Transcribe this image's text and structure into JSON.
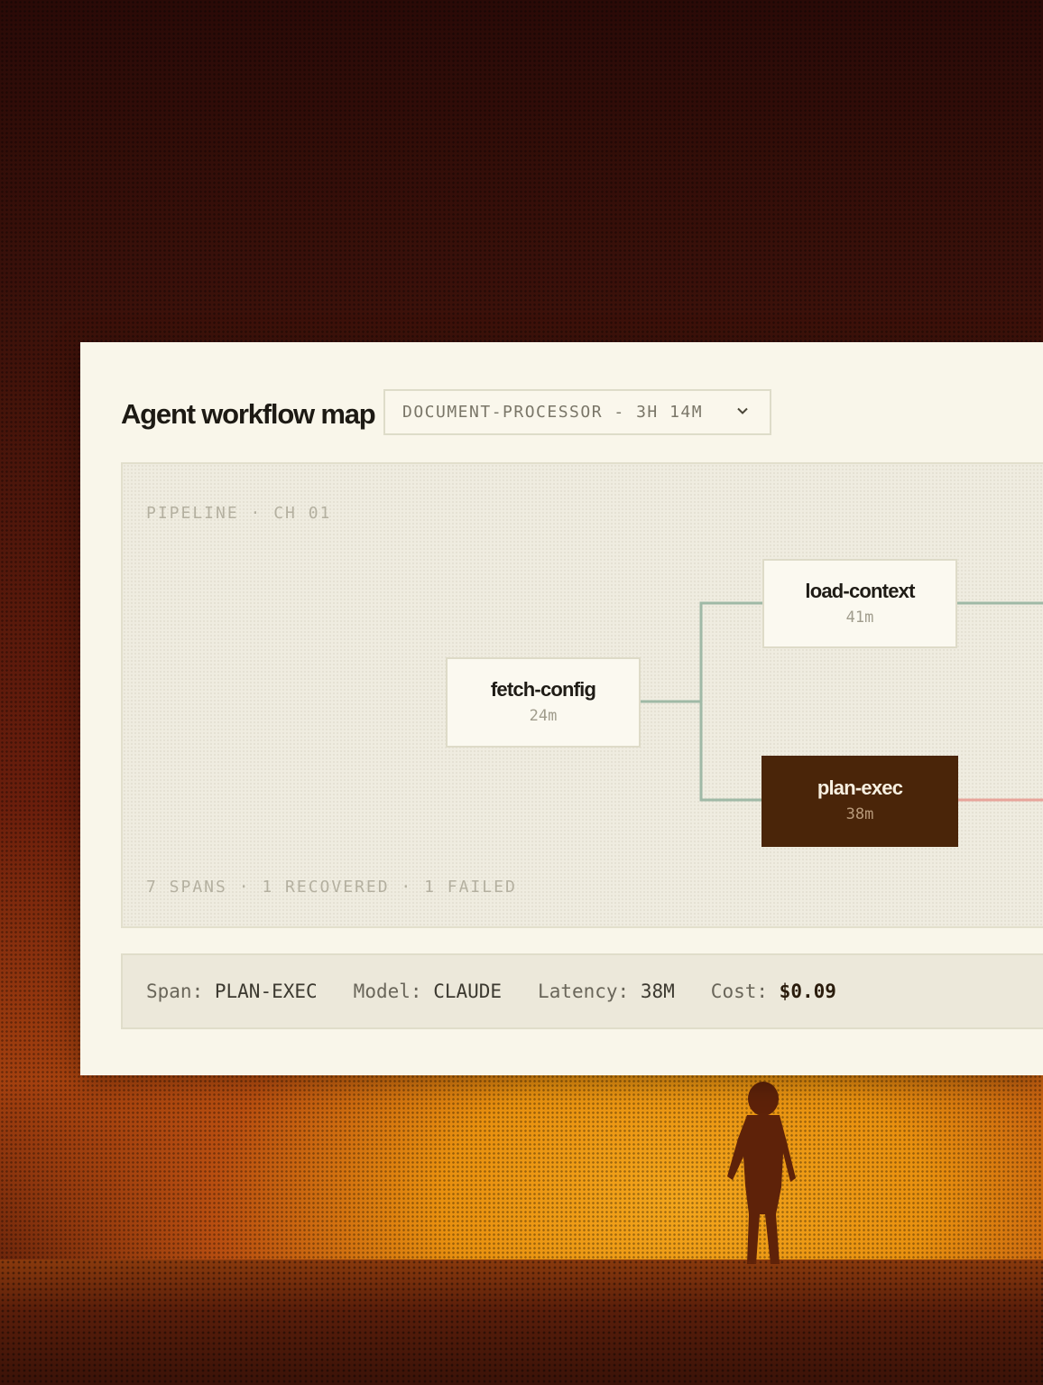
{
  "header": {
    "title": "Agent workflow map",
    "selector": {
      "value": "DOCUMENT-PROCESSOR - 3H 14M",
      "icon": "chevron-down-icon"
    }
  },
  "pipeline": {
    "label": "PIPELINE · CH 01",
    "stats": "7 SPANS · 1 RECOVERED · 1 FAILED",
    "nodes": [
      {
        "name": "fetch-config",
        "duration": "24m",
        "state": "default"
      },
      {
        "name": "load-context",
        "duration": "41m",
        "state": "default"
      },
      {
        "name": "plan-exec",
        "duration": "38m",
        "state": "selected"
      }
    ],
    "colors": {
      "edge_ok": "#9fb9a6",
      "edge_failed": "#e8a49a",
      "selected_node": "#4a2509"
    }
  },
  "span_info": {
    "span_label": "Span:",
    "span_value": "PLAN-EXEC",
    "model_label": "Model:",
    "model_value": "CLAUDE",
    "latency_label": "Latency:",
    "latency_value": "38M",
    "cost_label": "Cost:",
    "cost_value": "$0.09"
  }
}
